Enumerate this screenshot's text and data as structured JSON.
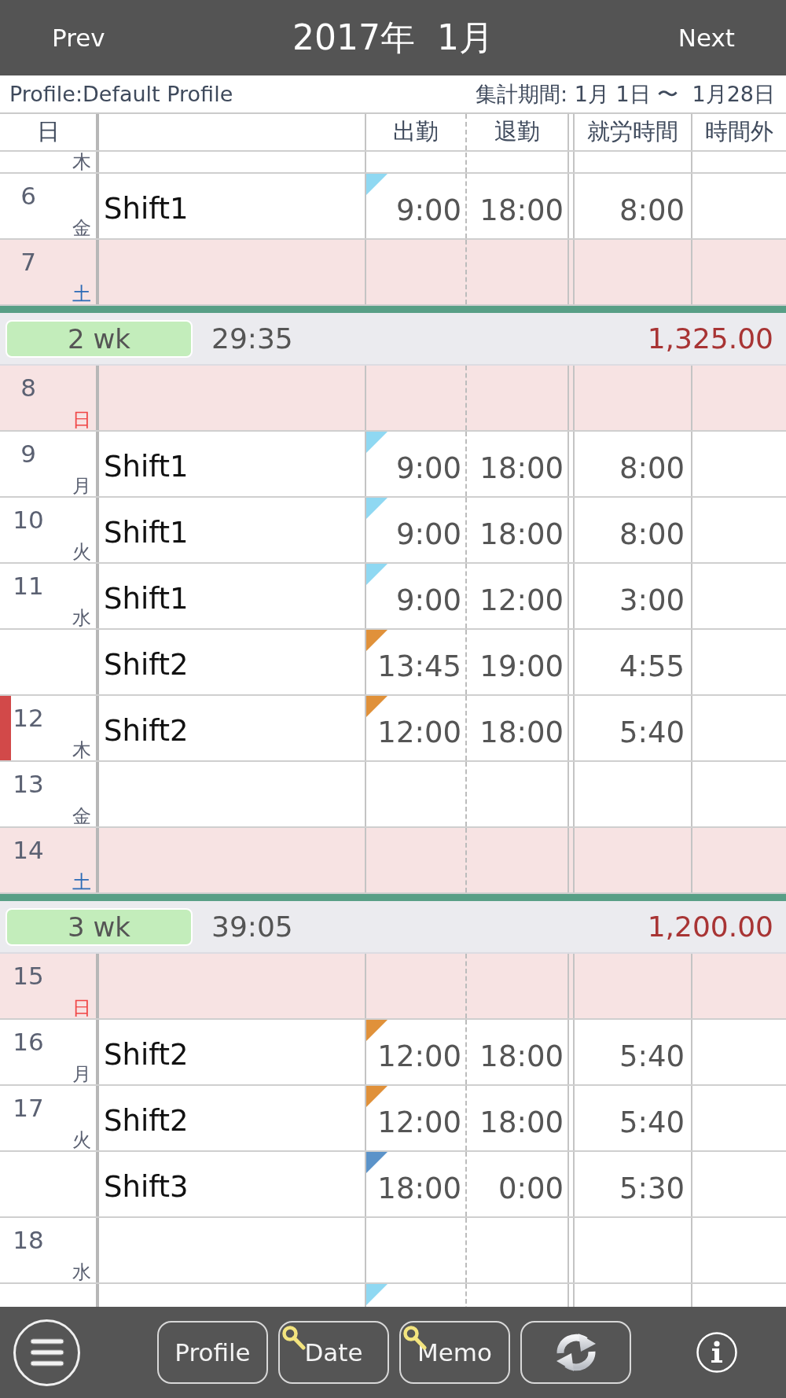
{
  "header": {
    "prev": "Prev",
    "title": "2017年  1月",
    "next": "Next"
  },
  "profile_bar": {
    "profile": "Profile:Default Profile",
    "period": "集計期間: 1月 1日 〜  1月28日"
  },
  "columns": {
    "day": "日",
    "clock_in": "出勤",
    "clock_out": "退勤",
    "work_time": "就労時間",
    "overtime": "時間外"
  },
  "rows": [
    {
      "kind": "weekday",
      "weekday": "木",
      "today": false
    },
    {
      "kind": "weekday",
      "day": "6",
      "weekday": "金",
      "today": false,
      "shifts": [
        {
          "name": "Shift1",
          "color": "#8fd8f2",
          "clock_in": "9:00",
          "clock_out": "18:00",
          "work_time": "8:00"
        }
      ]
    },
    {
      "kind": "saturday",
      "day": "7",
      "weekday": "土",
      "today": false
    },
    {
      "kind": "week",
      "label": "2 wk",
      "total": "29:35",
      "amount": "1,325.00"
    },
    {
      "kind": "sunday",
      "day": "8",
      "weekday": "日",
      "today": false
    },
    {
      "kind": "weekday",
      "day": "9",
      "weekday": "月",
      "today": false,
      "shifts": [
        {
          "name": "Shift1",
          "color": "#8fd8f2",
          "clock_in": "9:00",
          "clock_out": "18:00",
          "work_time": "8:00"
        }
      ]
    },
    {
      "kind": "weekday",
      "day": "10",
      "weekday": "火",
      "today": false,
      "shifts": [
        {
          "name": "Shift1",
          "color": "#8fd8f2",
          "clock_in": "9:00",
          "clock_out": "18:00",
          "work_time": "8:00"
        }
      ]
    },
    {
      "kind": "weekday",
      "day": "11",
      "weekday": "水",
      "today": false,
      "shifts": [
        {
          "name": "Shift1",
          "color": "#8fd8f2",
          "clock_in": "9:00",
          "clock_out": "12:00",
          "work_time": "3:00"
        },
        {
          "name": "Shift2",
          "color": "#e0913a",
          "clock_in": "13:45",
          "clock_out": "19:00",
          "work_time": "4:55"
        }
      ]
    },
    {
      "kind": "weekday",
      "day": "12",
      "weekday": "木",
      "today": true,
      "shifts": [
        {
          "name": "Shift2",
          "color": "#e0913a",
          "clock_in": "12:00",
          "clock_out": "18:00",
          "work_time": "5:40"
        }
      ]
    },
    {
      "kind": "weekday",
      "day": "13",
      "weekday": "金",
      "today": false
    },
    {
      "kind": "saturday",
      "day": "14",
      "weekday": "土",
      "today": false
    },
    {
      "kind": "week",
      "label": "3 wk",
      "total": "39:05",
      "amount": "1,200.00"
    },
    {
      "kind": "sunday",
      "day": "15",
      "weekday": "日",
      "today": false
    },
    {
      "kind": "weekday",
      "day": "16",
      "weekday": "月",
      "today": false,
      "shifts": [
        {
          "name": "Shift2",
          "color": "#e0913a",
          "clock_in": "12:00",
          "clock_out": "18:00",
          "work_time": "5:40"
        }
      ]
    },
    {
      "kind": "weekday",
      "day": "17",
      "weekday": "火",
      "today": false,
      "shifts": [
        {
          "name": "Shift2",
          "color": "#e0913a",
          "clock_in": "12:00",
          "clock_out": "18:00",
          "work_time": "5:40"
        },
        {
          "name": "Shift3",
          "color": "#5b93c9",
          "clock_in": "18:00",
          "clock_out": "0:00",
          "work_time": "5:30"
        }
      ]
    },
    {
      "kind": "weekday",
      "day": "18",
      "weekday": "水",
      "today": false
    },
    {
      "kind": "weekday",
      "today": false,
      "shifts": [
        {
          "color": "#8fd8f2"
        }
      ]
    }
  ],
  "toolbar": {
    "buttons": [
      {
        "kind": "menu"
      },
      {
        "kind": "text",
        "label": "Profile",
        "locked": false
      },
      {
        "kind": "text",
        "label": "Date",
        "locked": true
      },
      {
        "kind": "text",
        "label": "Memo",
        "locked": true
      },
      {
        "kind": "refresh"
      },
      {
        "kind": "info"
      }
    ]
  }
}
